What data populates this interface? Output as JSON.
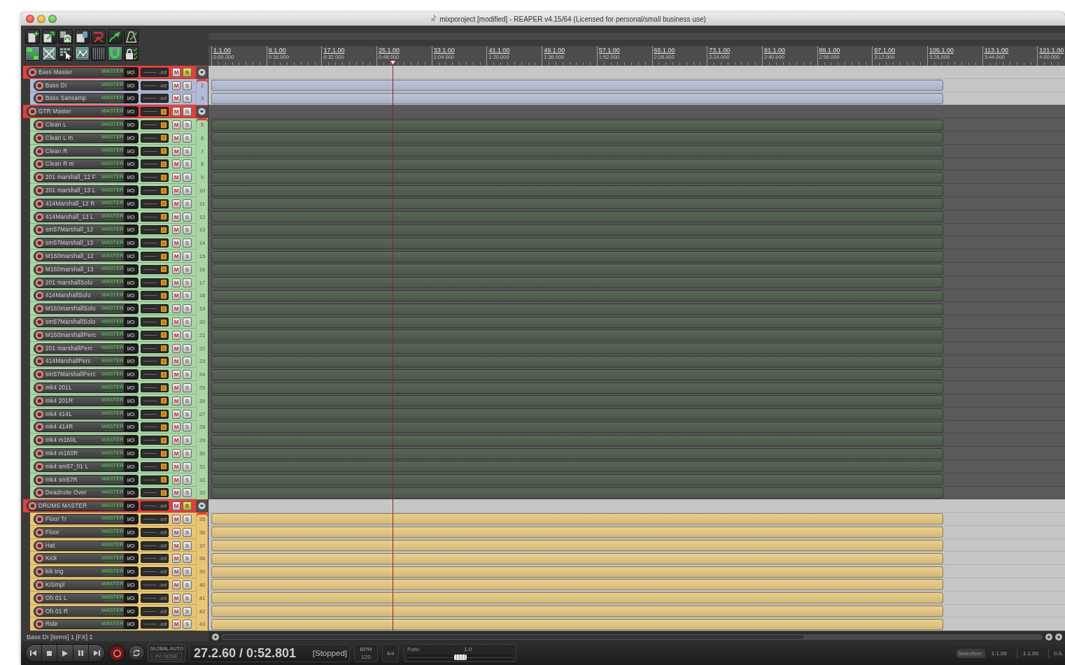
{
  "window": {
    "title": "mixporoject [modified] - REAPER v4.15/64 (Licensed for personal/small business use)"
  },
  "toolbar": [
    [
      {
        "kind": "page_plus",
        "on": false
      },
      {
        "kind": "page_arrow",
        "on": false
      },
      {
        "kind": "pages_cycle",
        "on": false
      },
      {
        "kind": "page_tab",
        "on": false
      },
      {
        "kind": "squiggle",
        "on": false
      },
      {
        "kind": "curve_arrow",
        "on": false
      },
      {
        "kind": "metronome",
        "on": false
      }
    ],
    [
      {
        "kind": "blocks",
        "on": true
      },
      {
        "kind": "crossfade",
        "on": true
      },
      {
        "kind": "grid_pointer",
        "on": false
      },
      {
        "kind": "envelope",
        "on": true
      },
      {
        "kind": "grid_lines",
        "on": false
      },
      {
        "kind": "magnet",
        "on": true
      },
      {
        "kind": "lock",
        "on": false
      }
    ]
  ],
  "ruler": [
    {
      "bar": "1.1.00",
      "time": "0:00.000"
    },
    {
      "bar": "9.1.00",
      "time": "0:16.000"
    },
    {
      "bar": "17.1.00",
      "time": "0:32.000"
    },
    {
      "bar": "25.1.00",
      "time": "0:48.000"
    },
    {
      "bar": "33.1.00",
      "time": "1:04.000"
    },
    {
      "bar": "41.1.00",
      "time": "1:20.000"
    },
    {
      "bar": "49.1.00",
      "time": "1:36.000"
    },
    {
      "bar": "57.1.00",
      "time": "1:52.000"
    },
    {
      "bar": "65.1.00",
      "time": "2:08.000"
    },
    {
      "bar": "73.1.00",
      "time": "2:24.000"
    },
    {
      "bar": "81.1.00",
      "time": "2:40.000"
    },
    {
      "bar": "89.1.00",
      "time": "2:56.000"
    },
    {
      "bar": "97.1.00",
      "time": "3:12.000"
    },
    {
      "bar": "105.1.00",
      "time": "3:28.000"
    },
    {
      "bar": "113.1.00",
      "time": "3:44.000"
    },
    {
      "bar": "121.1.00",
      "time": "4:00.000"
    }
  ],
  "tracks": [
    {
      "name": "Bass Master",
      "color": "#e3403b",
      "send": "MASTER",
      "io": "I/O",
      "meter": {
        "kind": "reading",
        "text": "-inf"
      },
      "mute": "M",
      "solo": "S",
      "soloed": true,
      "expanded": true,
      "dark_lanes": false,
      "children": [
        {
          "name": "Bass DI",
          "number": "2",
          "color": "#b3bad6",
          "send": "MASTER",
          "io": "I/O",
          "meter": {
            "kind": "reading",
            "text": "-inf"
          },
          "mute": "M",
          "solo": "S",
          "soloed": false
        },
        {
          "name": "Bass Sansamp",
          "number": "3",
          "color": "#b3bad6",
          "send": "MASTER",
          "io": "I/O",
          "meter": {
            "kind": "reading",
            "text": "-inf"
          },
          "mute": "M",
          "solo": "S",
          "soloed": false
        }
      ]
    },
    {
      "name": "GTR Master",
      "color": "#e3403b",
      "send": "MASTER",
      "io": "I/O",
      "meter": {
        "kind": "knob"
      },
      "mute": "M",
      "solo": "S",
      "soloed": false,
      "expanded": true,
      "dark_lanes": true,
      "children": [
        {
          "name": "Clean L",
          "number": "5",
          "color": "#a9d6a5",
          "send": "MASTER",
          "io": "I/O",
          "meter": {
            "kind": "knob"
          },
          "mute": "M",
          "solo": "S",
          "soloed": false
        },
        {
          "name": "Clean L m",
          "number": "6",
          "color": "#a9d6a5",
          "send": "MASTER",
          "io": "I/O",
          "meter": {
            "kind": "knob"
          },
          "mute": "M",
          "solo": "S",
          "soloed": false
        },
        {
          "name": "Clean R",
          "number": "7",
          "color": "#a9d6a5",
          "send": "MASTER",
          "io": "I/O",
          "meter": {
            "kind": "knob"
          },
          "mute": "M",
          "solo": "S",
          "soloed": false
        },
        {
          "name": "Clean R m",
          "number": "8",
          "color": "#a9d6a5",
          "send": "MASTER",
          "io": "I/O",
          "meter": {
            "kind": "knob"
          },
          "mute": "M",
          "solo": "S",
          "soloed": false
        },
        {
          "name": "201 marshall_12 F",
          "number": "9",
          "color": "#a9d6a5",
          "send": "MASTER",
          "io": "I/O",
          "meter": {
            "kind": "knob"
          },
          "mute": "M",
          "solo": "S",
          "soloed": false
        },
        {
          "name": "201 marshall_13 L",
          "number": "10",
          "color": "#a9d6a5",
          "send": "MASTER",
          "io": "I/O",
          "meter": {
            "kind": "knob"
          },
          "mute": "M",
          "solo": "S",
          "soloed": false
        },
        {
          "name": "414Marshall_12 R",
          "number": "11",
          "color": "#a9d6a5",
          "send": "MASTER",
          "io": "I/O",
          "meter": {
            "kind": "knob"
          },
          "mute": "M",
          "solo": "S",
          "soloed": false
        },
        {
          "name": "414Marshall_13 L",
          "number": "12",
          "color": "#a9d6a5",
          "send": "MASTER",
          "io": "I/O",
          "meter": {
            "kind": "knob"
          },
          "mute": "M",
          "solo": "S",
          "soloed": false
        },
        {
          "name": "sm57Marshall_12",
          "number": "13",
          "color": "#a9d6a5",
          "send": "MASTER",
          "io": "I/O",
          "meter": {
            "kind": "knob"
          },
          "mute": "M",
          "solo": "S",
          "soloed": false
        },
        {
          "name": "sm57Marshall_13",
          "number": "14",
          "color": "#a9d6a5",
          "send": "MASTER",
          "io": "I/O",
          "meter": {
            "kind": "knob"
          },
          "mute": "M",
          "solo": "S",
          "soloed": false
        },
        {
          "name": "M160marshall_12",
          "number": "15",
          "color": "#a9d6a5",
          "send": "MASTER",
          "io": "I/O",
          "meter": {
            "kind": "knob"
          },
          "mute": "M",
          "solo": "S",
          "soloed": false
        },
        {
          "name": "M160marshall_13",
          "number": "16",
          "color": "#a9d6a5",
          "send": "MASTER",
          "io": "I/O",
          "meter": {
            "kind": "knob"
          },
          "mute": "M",
          "solo": "S",
          "soloed": false
        },
        {
          "name": "201 marshallSolo",
          "number": "17",
          "color": "#a9d6a5",
          "send": "MASTER",
          "io": "I/O",
          "meter": {
            "kind": "knob"
          },
          "mute": "M",
          "solo": "S",
          "soloed": false
        },
        {
          "name": "414MarshallSolo",
          "number": "18",
          "color": "#a9d6a5",
          "send": "MASTER",
          "io": "I/O",
          "meter": {
            "kind": "knob"
          },
          "mute": "M",
          "solo": "S",
          "soloed": false
        },
        {
          "name": "M160marshallSolo",
          "number": "19",
          "color": "#a9d6a5",
          "send": "MASTER",
          "io": "I/O",
          "meter": {
            "kind": "knob"
          },
          "mute": "M",
          "solo": "S",
          "soloed": false
        },
        {
          "name": "sm57MarshallSolo",
          "number": "20",
          "color": "#a9d6a5",
          "send": "MASTER",
          "io": "I/O",
          "meter": {
            "kind": "knob"
          },
          "mute": "M",
          "solo": "S",
          "soloed": false
        },
        {
          "name": "M160marshallPerc",
          "number": "21",
          "color": "#a9d6a5",
          "send": "MASTER",
          "io": "I/O",
          "meter": {
            "kind": "knob"
          },
          "mute": "M",
          "solo": "S",
          "soloed": false
        },
        {
          "name": "201 marshallPerc",
          "number": "22",
          "color": "#a9d6a5",
          "send": "MASTER",
          "io": "I/O",
          "meter": {
            "kind": "knob"
          },
          "mute": "M",
          "solo": "S",
          "soloed": false
        },
        {
          "name": "414MarshallPerc",
          "number": "23",
          "color": "#a9d6a5",
          "send": "MASTER",
          "io": "I/O",
          "meter": {
            "kind": "knob"
          },
          "mute": "M",
          "solo": "S",
          "soloed": false
        },
        {
          "name": "sm57MarshallPerc",
          "number": "24",
          "color": "#a9d6a5",
          "send": "MASTER",
          "io": "I/O",
          "meter": {
            "kind": "knob"
          },
          "mute": "M",
          "solo": "S",
          "soloed": false
        },
        {
          "name": "mk4 201L",
          "number": "25",
          "color": "#a9d6a5",
          "send": "MASTER",
          "io": "I/O",
          "meter": {
            "kind": "knob"
          },
          "mute": "M",
          "solo": "S",
          "soloed": false
        },
        {
          "name": "mk4 201R",
          "number": "26",
          "color": "#a9d6a5",
          "send": "MASTER",
          "io": "I/O",
          "meter": {
            "kind": "knob"
          },
          "mute": "M",
          "solo": "S",
          "soloed": false
        },
        {
          "name": "mk4 414L",
          "number": "27",
          "color": "#a9d6a5",
          "send": "MASTER",
          "io": "I/O",
          "meter": {
            "kind": "knob"
          },
          "mute": "M",
          "solo": "S",
          "soloed": false
        },
        {
          "name": "mk4 414R",
          "number": "28",
          "color": "#a9d6a5",
          "send": "MASTER",
          "io": "I/O",
          "meter": {
            "kind": "knob"
          },
          "mute": "M",
          "solo": "S",
          "soloed": false
        },
        {
          "name": "mk4 m160L",
          "number": "29",
          "color": "#a9d6a5",
          "send": "MASTER",
          "io": "I/O",
          "meter": {
            "kind": "knob"
          },
          "mute": "M",
          "solo": "S",
          "soloed": false
        },
        {
          "name": "mk4 m160R",
          "number": "30",
          "color": "#a9d6a5",
          "send": "MASTER",
          "io": "I/O",
          "meter": {
            "kind": "knob"
          },
          "mute": "M",
          "solo": "S",
          "soloed": false
        },
        {
          "name": "mk4 sm57_01 L",
          "number": "31",
          "color": "#a9d6a5",
          "send": "MASTER",
          "io": "I/O",
          "meter": {
            "kind": "knob"
          },
          "mute": "M",
          "solo": "S",
          "soloed": false
        },
        {
          "name": "mk4 sm57R",
          "number": "32",
          "color": "#a9d6a5",
          "send": "MASTER",
          "io": "I/O",
          "meter": {
            "kind": "knob"
          },
          "mute": "M",
          "solo": "S",
          "soloed": false
        },
        {
          "name": "Deadnote Over",
          "number": "33",
          "color": "#a9d6a5",
          "send": "MASTER",
          "io": "I/O",
          "meter": {
            "kind": "knob"
          },
          "mute": "M",
          "solo": "S",
          "soloed": false
        }
      ]
    },
    {
      "name": "DRUMS MASTER",
      "color": "#e3403b",
      "send": "MASTER",
      "io": "I/O",
      "meter": {
        "kind": "reading",
        "text": "-inf"
      },
      "mute": "M",
      "solo": "S",
      "soloed": true,
      "expanded": true,
      "dark_lanes": false,
      "children": [
        {
          "name": "Floor Tr",
          "number": "35",
          "color": "#e9c676",
          "send": "MASTER",
          "io": "I/O",
          "meter": {
            "kind": "reading",
            "text": "-inf"
          },
          "mute": "M",
          "solo": "S",
          "soloed": false
        },
        {
          "name": "Floor",
          "number": "36",
          "color": "#e9c676",
          "send": "MASTER",
          "io": "I/O",
          "meter": {
            "kind": "reading",
            "text": "-inf"
          },
          "mute": "M",
          "solo": "S",
          "soloed": false
        },
        {
          "name": "Hat",
          "number": "37",
          "color": "#e9c676",
          "send": "MASTER",
          "io": "I/O",
          "meter": {
            "kind": "reading",
            "text": "-inf"
          },
          "mute": "M",
          "solo": "S",
          "soloed": false
        },
        {
          "name": "Kick",
          "number": "38",
          "color": "#e9c676",
          "send": "MASTER",
          "io": "I/O",
          "meter": {
            "kind": "reading",
            "text": "-inf"
          },
          "mute": "M",
          "solo": "S",
          "soloed": false
        },
        {
          "name": "kik trig",
          "number": "39",
          "color": "#e9c676",
          "send": "MASTER",
          "io": "I/O",
          "meter": {
            "kind": "reading",
            "text": "-inf"
          },
          "mute": "M",
          "solo": "S",
          "soloed": false
        },
        {
          "name": "KiSmpl",
          "number": "40",
          "color": "#e9c676",
          "send": "MASTER",
          "io": "I/O",
          "meter": {
            "kind": "reading",
            "text": "-inf"
          },
          "mute": "M",
          "solo": "S",
          "soloed": false
        },
        {
          "name": "Oh.01 L",
          "number": "41",
          "color": "#e9c676",
          "send": "MASTER",
          "io": "I/O",
          "meter": {
            "kind": "reading",
            "text": "-inf"
          },
          "mute": "M",
          "solo": "S",
          "soloed": false
        },
        {
          "name": "Oh.01 R",
          "number": "42",
          "color": "#e9c676",
          "send": "MASTER",
          "io": "I/O",
          "meter": {
            "kind": "reading",
            "text": "-inf"
          },
          "mute": "M",
          "solo": "S",
          "soloed": false
        },
        {
          "name": "Ride",
          "number": "43",
          "color": "#e9c676",
          "send": "MASTER",
          "io": "I/O",
          "meter": {
            "kind": "reading",
            "text": "-inf"
          },
          "mute": "M",
          "solo": "S",
          "soloed": false
        }
      ]
    }
  ],
  "status_bar": "Bass DI [items] 1 [FX] 1",
  "transport": {
    "global_auto": {
      "label": "GLOBAL AUTO",
      "mode": "NONE"
    },
    "position": "27.2.60 / 0:52.801",
    "play_state": "[Stopped]",
    "tempo": {
      "label": "BPM",
      "value": "120"
    },
    "time_signature": "4/4",
    "rate": {
      "label": "Rate:",
      "value": "1.0",
      "level": 0.5
    }
  },
  "selection": {
    "label": "Selection:",
    "start": "1.1.00",
    "end": "1.1.00",
    "length": "0.0."
  }
}
